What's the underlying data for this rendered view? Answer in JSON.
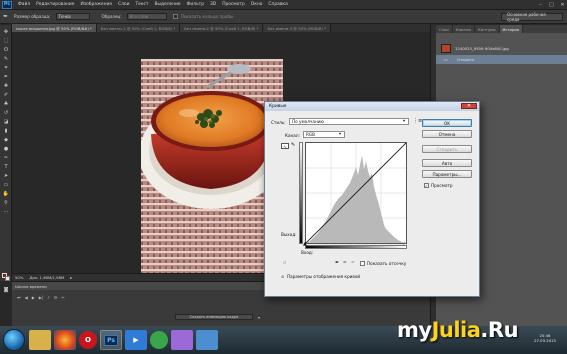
{
  "app": {
    "logo": "Ps"
  },
  "menu": [
    "Файл",
    "Редактирование",
    "Изображение",
    "Слои",
    "Текст",
    "Выделение",
    "Фильтр",
    "3D",
    "Просмотр",
    "Окно",
    "Справка"
  ],
  "options": {
    "sample_size_label": "Размер образца:",
    "sample_size_value": "Точка",
    "sample_label": "Образец:",
    "sample_value": "Все слои",
    "show_ring": "Показать кольцо пробы",
    "workspace": "Основная рабочая среда"
  },
  "doc_tabs": [
    "после вскрытия.jpg @ 50% (RGB/8#) *",
    "Без имени-1 @ 50% (Слой 1, RGB/8) *",
    "Без имени-2 @ 50% (Слой 1, RGB/8) *",
    "Без имени-3 @ 50% (RGB/8) *"
  ],
  "status": {
    "zoom": "50%",
    "doc": "Док: 1,98M/1,98M"
  },
  "timeline": {
    "title": "Шкала времени",
    "make_button": "Создать анимацию кадра"
  },
  "right_panel": {
    "tabs": [
      "Слои",
      "Каналы",
      "Контуры",
      "История"
    ],
    "history": [
      {
        "label": "1240023_9559-900x600.jpg",
        "selected": false,
        "snapshot": true
      },
      {
        "label": "Открыть",
        "selected": true,
        "snapshot": false
      }
    ]
  },
  "curves_dialog": {
    "title": "Кривые",
    "preset_label": "Стиль:",
    "preset_value": "По умолчанию",
    "channel_label": "Канал:",
    "channel_value": "RGB",
    "output_label": "Выход:",
    "input_label": "Вход:",
    "show_clipping": "Показать отсечку",
    "display_options": "Параметры отображения кривой",
    "buttons": {
      "ok": "OK",
      "cancel": "Отмена",
      "smooth": "Сгладить",
      "auto": "Авто",
      "options": "Параметры...",
      "preview": "Просмотр"
    },
    "preview_checked": true
  },
  "taskbar": {
    "icons": [
      "folder",
      "firefox",
      "opera",
      "photoshop",
      "media",
      "app",
      "app2",
      "app3"
    ]
  },
  "watermark": {
    "prefix": "my",
    "accent": "Julia",
    "suffix": ".Ru"
  },
  "clock": {
    "time": "20:46",
    "date": "27.03.2015"
  }
}
